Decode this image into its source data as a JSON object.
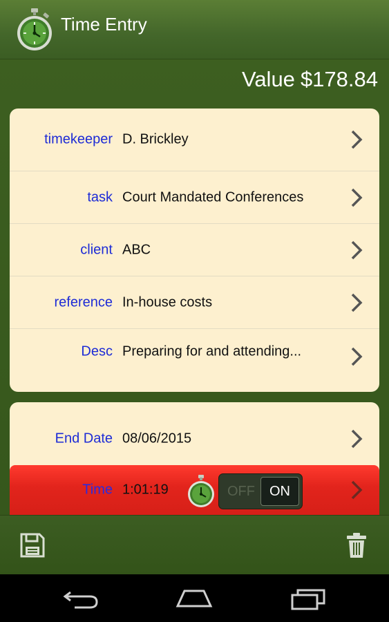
{
  "app": {
    "title": "Time Entry",
    "icon": "stopwatch-icon"
  },
  "value": {
    "label": "Value",
    "amount": "$178.84"
  },
  "details": [
    {
      "label": "timekeeper",
      "value": "D. Brickley"
    },
    {
      "label": "task",
      "value": "Court Mandated Conferences"
    },
    {
      "label": "client",
      "value": "ABC"
    },
    {
      "label": "reference",
      "value": "In-house costs"
    },
    {
      "label": "Desc",
      "value": "Preparing for and attending..."
    }
  ],
  "timing": {
    "end_date_label": "End Date",
    "end_date_value": "08/06/2015",
    "time_label": "Time",
    "time_value": "1:01:19",
    "toggle_off": "OFF",
    "toggle_on": "ON",
    "toggle_state": "on"
  },
  "actions": {
    "save": "save-icon",
    "delete": "trash-icon"
  },
  "navbar": {
    "back": "back-icon",
    "home": "home-icon",
    "recent": "recent-apps-icon"
  },
  "colors": {
    "label_blue": "#1d2bd6",
    "card_bg": "#fdf0cf",
    "timer_red": "#e2241c",
    "header_green": "#43662a"
  }
}
